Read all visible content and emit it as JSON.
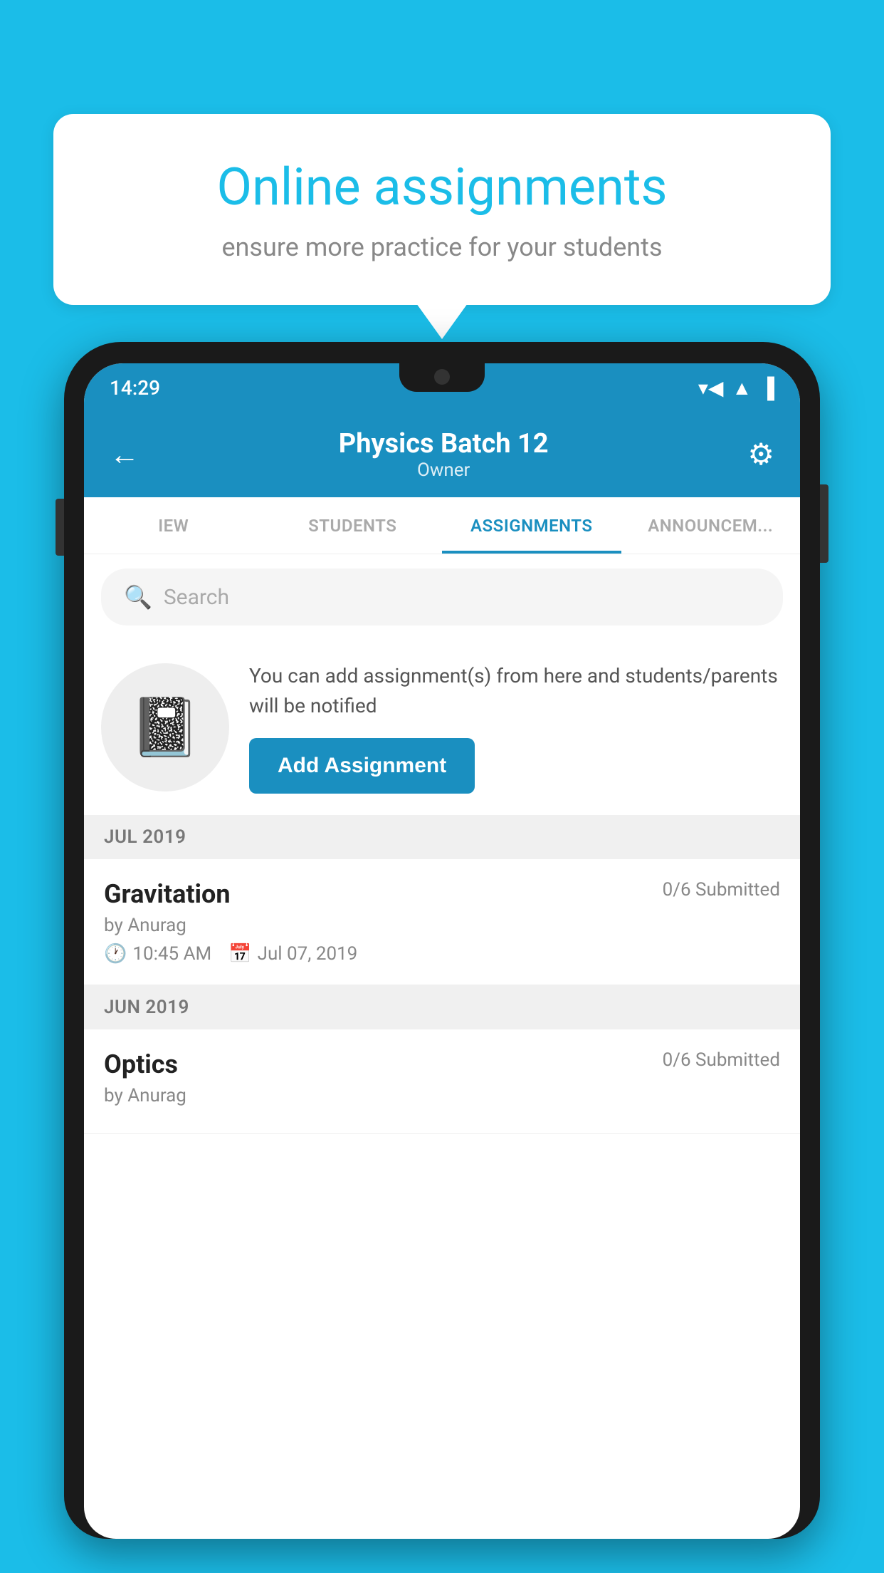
{
  "background_color": "#1BBDE8",
  "bubble": {
    "title": "Online assignments",
    "subtitle": "ensure more practice for your students"
  },
  "status_bar": {
    "time": "14:29",
    "wifi": "▼",
    "signal": "▲",
    "battery": "▮"
  },
  "header": {
    "title": "Physics Batch 12",
    "subtitle": "Owner",
    "back_label": "←",
    "settings_label": "⚙"
  },
  "tabs": [
    {
      "id": "iew",
      "label": "IEW",
      "active": false
    },
    {
      "id": "students",
      "label": "STUDENTS",
      "active": false
    },
    {
      "id": "assignments",
      "label": "ASSIGNMENTS",
      "active": true
    },
    {
      "id": "announcements",
      "label": "ANNOUNCEM...",
      "active": false
    }
  ],
  "search": {
    "placeholder": "Search"
  },
  "info_card": {
    "text": "You can add assignment(s) from here and students/parents will be notified",
    "button_label": "Add Assignment"
  },
  "sections": [
    {
      "id": "jul2019",
      "label": "JUL 2019",
      "assignments": [
        {
          "id": "gravitation",
          "title": "Gravitation",
          "status": "0/6 Submitted",
          "author": "by Anurag",
          "time": "10:45 AM",
          "date": "Jul 07, 2019"
        }
      ]
    },
    {
      "id": "jun2019",
      "label": "JUN 2019",
      "assignments": [
        {
          "id": "optics",
          "title": "Optics",
          "status": "0/6 Submitted",
          "author": "by Anurag",
          "time": "",
          "date": ""
        }
      ]
    }
  ]
}
